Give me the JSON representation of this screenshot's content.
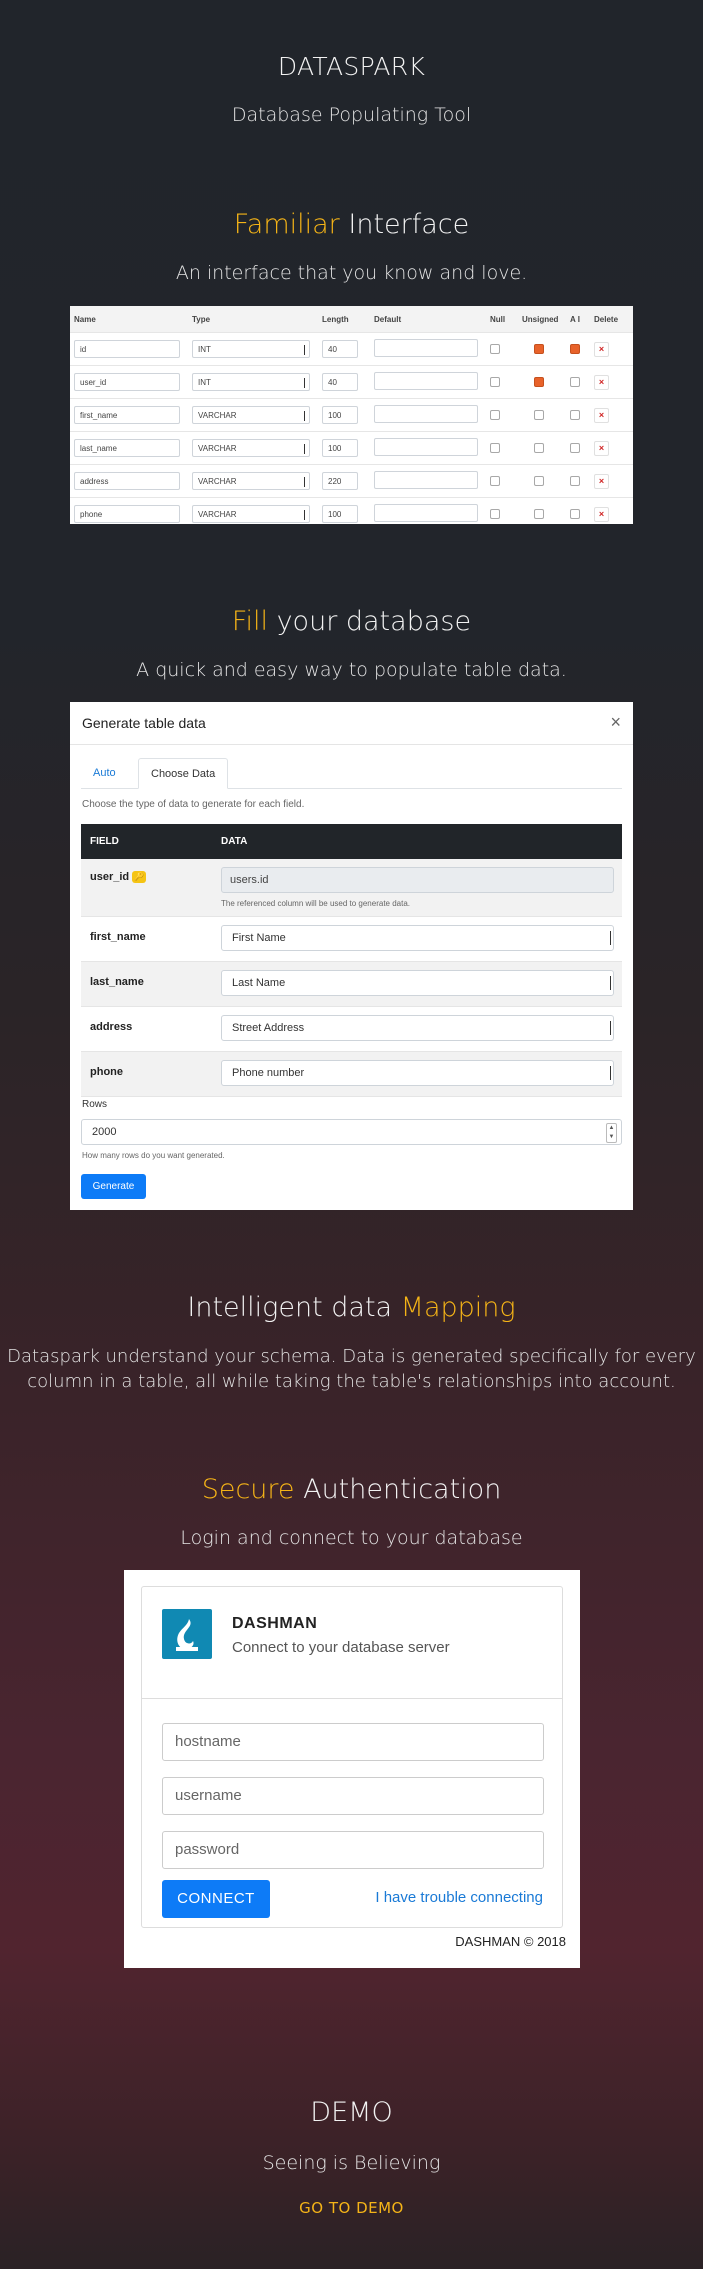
{
  "hero": {
    "title": "DATASPARK",
    "subtitle": "Database Populating Tool"
  },
  "interface_section": {
    "title_accent": "Familiar",
    "title_rest": " Interface",
    "description": "An interface that you know and love.",
    "table": {
      "headers": [
        "Name",
        "Type",
        "Length",
        "Default",
        "Null",
        "Unsigned",
        "A I",
        "Delete"
      ],
      "rows": [
        {
          "name": "id",
          "type": "INT",
          "length": "40",
          "null": false,
          "unsigned": true,
          "ai": true
        },
        {
          "name": "user_id",
          "type": "INT",
          "length": "40",
          "null": false,
          "unsigned": true,
          "ai": false
        },
        {
          "name": "first_name",
          "type": "VARCHAR",
          "length": "100",
          "null": false,
          "unsigned": false,
          "ai": false
        },
        {
          "name": "last_name",
          "type": "VARCHAR",
          "length": "100",
          "null": false,
          "unsigned": false,
          "ai": false
        },
        {
          "name": "address",
          "type": "VARCHAR",
          "length": "220",
          "null": false,
          "unsigned": false,
          "ai": false
        },
        {
          "name": "phone",
          "type": "VARCHAR",
          "length": "100",
          "null": false,
          "unsigned": false,
          "ai": false
        }
      ],
      "delete_glyph": "×"
    }
  },
  "fill_section": {
    "title_accent": "Fill",
    "title_rest": " your database",
    "description": "A quick and easy way to populate table data.",
    "modal": {
      "title": "Generate table data",
      "close_glyph": "×",
      "tabs": [
        "Auto",
        "Choose Data"
      ],
      "help": "Choose the type of data to generate for each field.",
      "col_field": "FIELD",
      "col_data": "DATA",
      "user_id": {
        "field": "user_id",
        "value": "users.id",
        "note": "The referenced column will be used to generate data."
      },
      "fields": [
        {
          "field": "first_name",
          "value": "First Name"
        },
        {
          "field": "last_name",
          "value": "Last Name"
        },
        {
          "field": "address",
          "value": "Street Address"
        },
        {
          "field": "phone",
          "value": "Phone number"
        }
      ],
      "rows_label": "Rows",
      "rows_value": "2000",
      "rows_help": "How many rows do you want generated.",
      "generate_label": "Generate"
    }
  },
  "mapping_section": {
    "title_plain": "Intelligent data ",
    "title_accent": "Mapping",
    "description_line1": "Dataspark understand your schema. Data is generated specifically for every",
    "description_line2": "column in a table, all while taking the table's relationships into account."
  },
  "auth_section": {
    "title_accent": "Secure",
    "title_rest": " Authentication",
    "description": "Login and connect to your database",
    "login": {
      "brand": "DASHMAN",
      "tagline": "Connect to your database server",
      "hostname_placeholder": "hostname",
      "username_placeholder": "username",
      "password_placeholder": "password",
      "connect_label": "CONNECT",
      "trouble_link": "I have trouble connecting",
      "copyright": "DASHMAN © 2018"
    }
  },
  "demo_section": {
    "title": "DEMO",
    "subtitle": "Seeing is Believing",
    "link": "GO TO DEMO"
  },
  "colors": {
    "accent": "#f5b417",
    "primary_button": "#0d7bf7",
    "background_top": "#21252b",
    "background_bottom": "#51242f"
  }
}
